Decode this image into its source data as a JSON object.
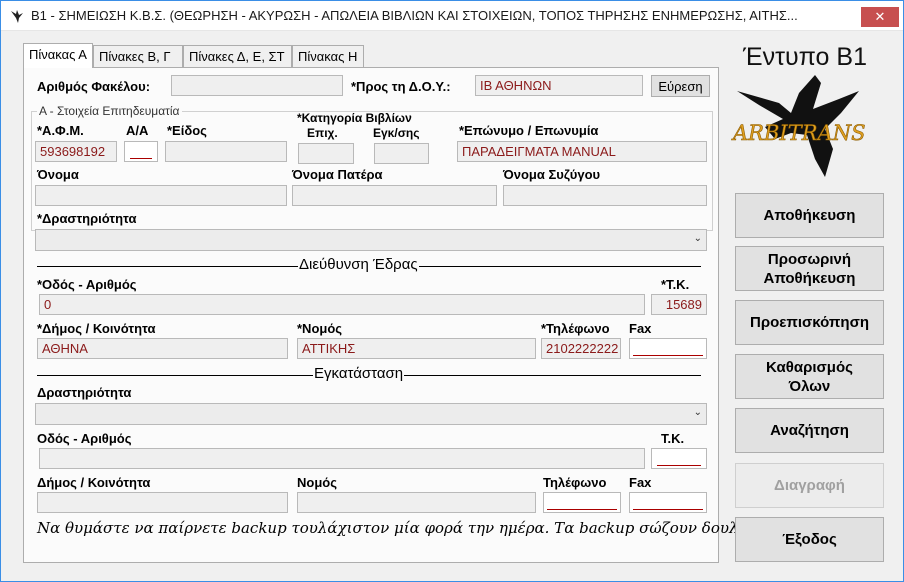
{
  "window": {
    "title": "B1 - ΣΗΜΕΙΩΣΗ Κ.Β.Σ. (ΘΕΩΡΗΣΗ - ΑΚΥΡΩΣΗ - ΑΠΩΛΕΙΑ ΒΙΒΛΙΩΝ ΚΑΙ ΣΤΟΙΧΕΙΩΝ, ΤΟΠΟΣ ΤΗΡΗΣΗΣ ΕΝΗΜΕΡΩΣΗΣ, ΑΙΤΗΣ...",
    "close_glyph": "✕"
  },
  "tabs": [
    "Πίνακας Α",
    "Πίνακες Β, Γ",
    "Πίνακες Δ, Ε, ΣΤ",
    "Πίνακας Η"
  ],
  "header": {
    "file_label": "Αριθμός Φακέλου:",
    "file_value": "",
    "doy_label": "*Προς τη Δ.Ο.Υ.:",
    "doy_value": "ΙΒ ΑΘΗΝΩΝ",
    "search_button": "Εύρεση"
  },
  "business": {
    "legend": "Α - Στοιχεία Επιτηδευματία",
    "afm_label": "*Α.Φ.Μ.",
    "afm_value": "593698192",
    "aa_label": "Α/Α",
    "aa_value": "",
    "type_label": "*Είδος",
    "type_value": "",
    "books_cat_label": "*Κατηγορία Βιβλίων",
    "epix_label": "Επιχ.",
    "epix_value": "",
    "egk_label": "Εγκ/σης",
    "egk_value": "",
    "surname_label": "*Επώνυμο / Επωνυμία",
    "surname_value": "ΠΑΡΑΔΕΙΓΜΑΤΑ MANUAL",
    "name_label": "Όνομα",
    "name_value": "",
    "father_label": "Όνομα Πατέρα",
    "father_value": "",
    "spouse_label": "Όνομα Συζύγου",
    "spouse_value": "",
    "activity_label": "*Δραστηριότητα",
    "activity_value": ""
  },
  "hq": {
    "section_title": "Διεύθυνση Έδρας",
    "street_label": "*Οδός - Αριθμός",
    "street_value": "0",
    "zip_label": "*Τ.Κ.",
    "zip_value": "15689",
    "municipality_label": "*Δήμος / Κοινότητα",
    "municipality_value": "ΑΘΗΝΑ",
    "prefecture_label": "*Νομός",
    "prefecture_value": "ΑΤΤΙΚΗΣ",
    "phone_label": "*Τηλέφωνο",
    "phone_value": "2102222222",
    "fax_label": "Fax",
    "fax_value": ""
  },
  "facility": {
    "section_title": "Εγκατάσταση",
    "activity_label": "Δραστηριότητα",
    "activity_value": "",
    "street_label": "Οδός - Αριθμός",
    "street_value": "",
    "zip_label": "Τ.Κ.",
    "zip_value": "",
    "municipality_label": "Δήμος / Κοινότητα",
    "municipality_value": "",
    "prefecture_label": "Νομός",
    "prefecture_value": "",
    "phone_label": "Τηλέφωνο",
    "phone_value": "",
    "fax_label": "Fax",
    "fax_value": ""
  },
  "footer_note": "Να θυμάστε να παίρνετε backup τουλάχιστον μία φορά την ημέρα. Τα backup σώζουν δουλειές!",
  "sidebar": {
    "form_title": "Έντυπο Β1",
    "logo_text": "ARBITRANS",
    "buttons": {
      "save": "Αποθήκευση",
      "temp_save_1": "Προσωρινή",
      "temp_save_2": "Αποθήκευση",
      "preview": "Προεπισκόπηση",
      "clear_1": "Καθαρισμός",
      "clear_2": "Όλων",
      "search": "Αναζήτηση",
      "delete": "Διαγραφή",
      "exit": "Έξοδος"
    }
  },
  "icons": {
    "select_chevron": "⌄"
  },
  "colors": {
    "value_text": "#8b1a1a",
    "logo_text": "#e0a020",
    "close_button": "#c74f4f"
  }
}
